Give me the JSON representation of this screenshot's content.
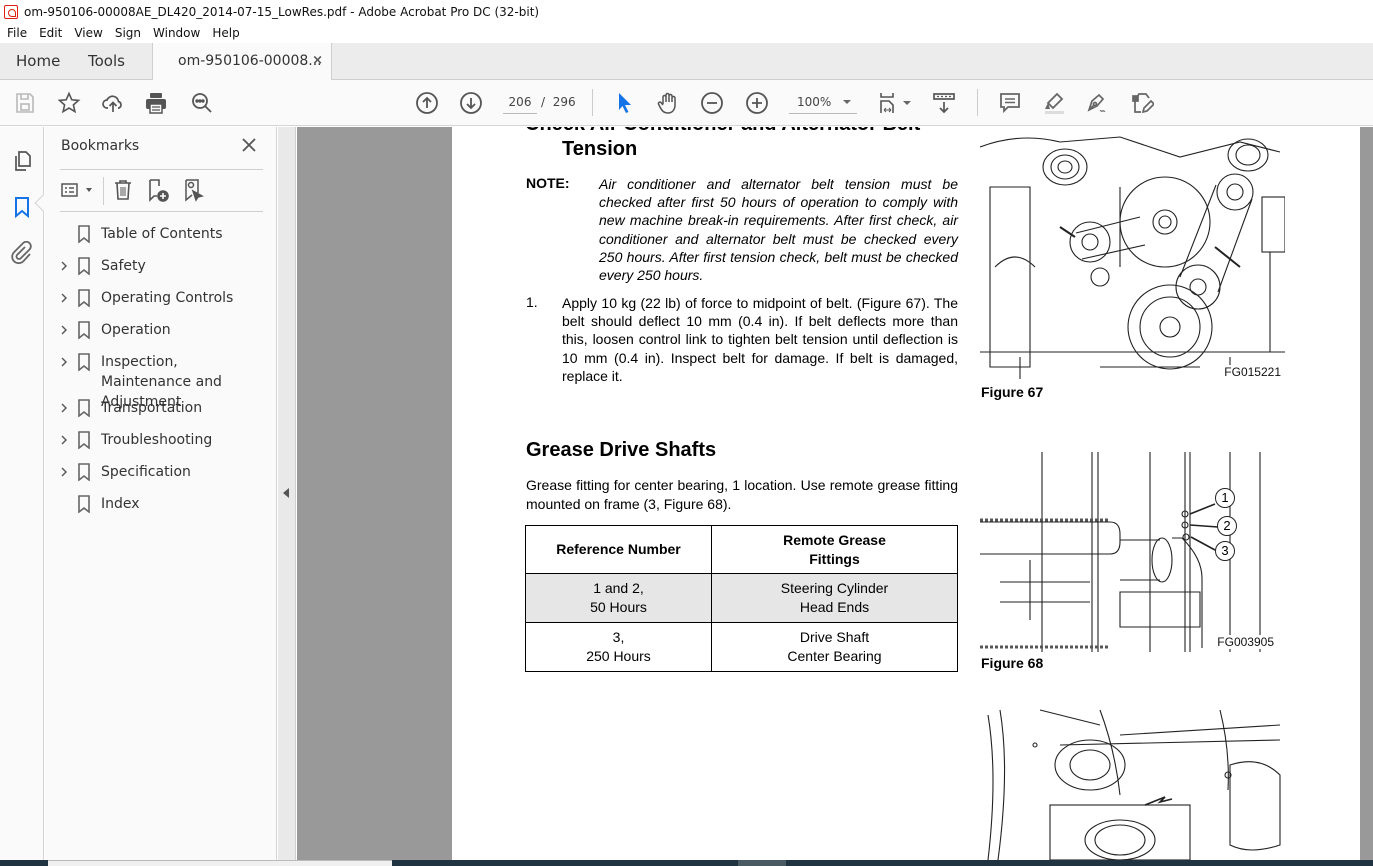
{
  "window": {
    "title": "om-950106-00008AE_DL420_2014-07-15_LowRes.pdf - Adobe Acrobat Pro DC (32-bit)",
    "app_icon": "acrobat-icon"
  },
  "menu": [
    "File",
    "Edit",
    "View",
    "Sign",
    "Window",
    "Help"
  ],
  "tabs": {
    "home": "Home",
    "tools": "Tools",
    "document": "om-950106-00008...",
    "close_glyph": "×"
  },
  "toolbar": {
    "icons_left": [
      "save-icon",
      "bookmark-star-icon",
      "upload-cloud-icon",
      "print-icon",
      "find-zoom-icon"
    ],
    "prev_page_icon": "arrow-up-circle-icon",
    "next_page_icon": "arrow-down-circle-icon",
    "current_page": "206",
    "page_separator": "/",
    "total_pages": "296",
    "select_tool_icon": "cursor-arrow-icon",
    "hand_tool_icon": "hand-icon",
    "zoom_out_icon": "minus-circle-icon",
    "zoom_in_icon": "plus-circle-icon",
    "zoom_level": "100%",
    "icons_right": [
      "fit-page-icon",
      "scroll-mode-icon",
      "comment-icon",
      "highlight-icon",
      "sign-icon",
      "edit-pdf-icon"
    ],
    "accent_color": "#1473e6"
  },
  "left_rail": {
    "items": [
      "page-thumbnails-icon",
      "bookmarks-icon",
      "attachments-icon"
    ],
    "active": "bookmarks-icon"
  },
  "bookmarks_panel": {
    "title": "Bookmarks",
    "tools": [
      "options-menu-icon",
      "delete-bookmark-icon",
      "new-bookmark-icon",
      "find-bookmark-icon"
    ],
    "items": [
      {
        "label": "Table of Contents",
        "expandable": false
      },
      {
        "label": "Safety",
        "expandable": true
      },
      {
        "label": "Operating Controls",
        "expandable": true
      },
      {
        "label": "Operation",
        "expandable": true
      },
      {
        "label": "Inspection, Maintenance and Adjustment",
        "expandable": true
      },
      {
        "label": "Transportation",
        "expandable": true
      },
      {
        "label": "Troubleshooting",
        "expandable": true
      },
      {
        "label": "Specification",
        "expandable": true
      },
      {
        "label": "Index",
        "expandable": false
      }
    ]
  },
  "document": {
    "heading_cut": "Check Air Conditioner and Alternator Belt",
    "heading_tension": "Tension",
    "note_label": "NOTE:",
    "note_text": "Air conditioner and alternator belt tension must be checked after first 50 hours of operation to comply with new machine break-in requirements. After first check, air conditioner and alternator belt must be checked every 250 hours. After first tension check, belt must be checked every 250 hours.",
    "step_number": "1.",
    "step_text": "Apply 10 kg (22 lb) of force to midpoint of belt. (Figure 67). The belt should deflect 10 mm (0.4 in). If belt deflects more than this, loosen control link to tighten belt tension until deflection is 10 mm (0.4 in). Inspect belt for damage. If belt is damaged, replace it.",
    "grease_heading": "Grease Drive Shafts",
    "grease_text": "Grease fitting for center bearing, 1 location. Use remote grease fitting mounted on frame (3, Figure 68).",
    "table": {
      "headers": [
        "Reference Number",
        "Remote Grease Fittings"
      ],
      "rows": [
        {
          "ref": "1 and 2,\n50 Hours",
          "ref_line1": "1 and 2,",
          "ref_line2": "50 Hours",
          "fit_line1": "Steering Cylinder",
          "fit_line2": "Head Ends"
        },
        {
          "ref": "3,\n250 Hours",
          "ref_line1": "3,",
          "ref_line2": "250 Hours",
          "fit_line1": "Drive Shaft",
          "fit_line2": "Center Bearing"
        }
      ],
      "header2_line1": "Remote Grease",
      "header2_line2": "Fittings"
    },
    "figures": [
      {
        "caption": "Figure 67",
        "code": "FG015221",
        "subject": "engine belt drive illustration"
      },
      {
        "caption": "Figure 68",
        "code": "FG003905",
        "subject": "remote grease fittings illustration",
        "callouts": [
          "1",
          "2",
          "3"
        ]
      },
      {
        "caption": "",
        "code": "",
        "subject": "drive shaft center bearing illustration"
      }
    ]
  }
}
